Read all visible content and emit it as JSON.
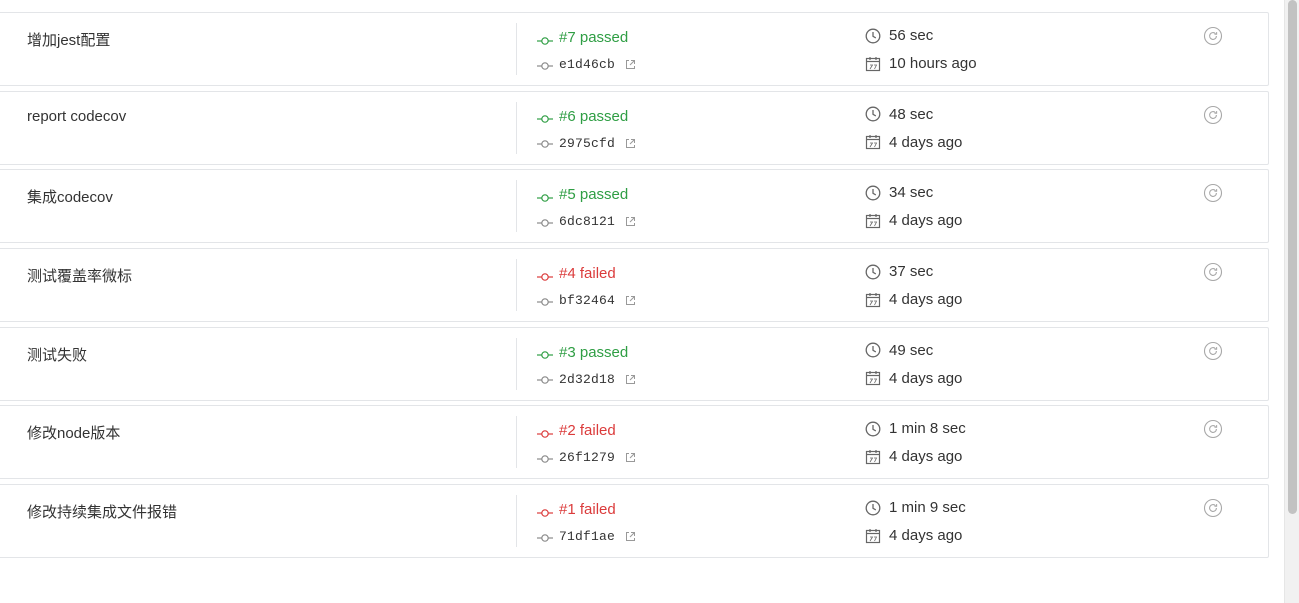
{
  "colors": {
    "passed": "#2f9e44",
    "failed": "#db3b3b",
    "border": "#e3e5e8",
    "text": "#333333",
    "icon": "#7d7d7d"
  },
  "builds": [
    {
      "message": "增加jest配置",
      "status_class": "passed",
      "status_label": "#7 passed",
      "commit": "e1d46cb",
      "duration": "56 sec",
      "finished": "10 hours ago"
    },
    {
      "message": "report codecov",
      "status_class": "passed",
      "status_label": "#6 passed",
      "commit": "2975cfd",
      "duration": "48 sec",
      "finished": "4 days ago"
    },
    {
      "message": "集成codecov",
      "status_class": "passed",
      "status_label": "#5 passed",
      "commit": "6dc8121",
      "duration": "34 sec",
      "finished": "4 days ago"
    },
    {
      "message": "测试覆盖率微标",
      "status_class": "failed",
      "status_label": "#4 failed",
      "commit": "bf32464",
      "duration": "37 sec",
      "finished": "4 days ago"
    },
    {
      "message": "测试失败",
      "status_class": "passed",
      "status_label": "#3 passed",
      "commit": "2d32d18",
      "duration": "49 sec",
      "finished": "4 days ago"
    },
    {
      "message": "修改node版本",
      "status_class": "failed",
      "status_label": "#2 failed",
      "commit": "26f1279",
      "duration": "1 min 8 sec",
      "finished": "4 days ago"
    },
    {
      "message": "修改持续集成文件报错",
      "status_class": "failed",
      "status_label": "#1 failed",
      "commit": "71df1ae",
      "duration": "1 min 9 sec",
      "finished": "4 days ago"
    }
  ]
}
